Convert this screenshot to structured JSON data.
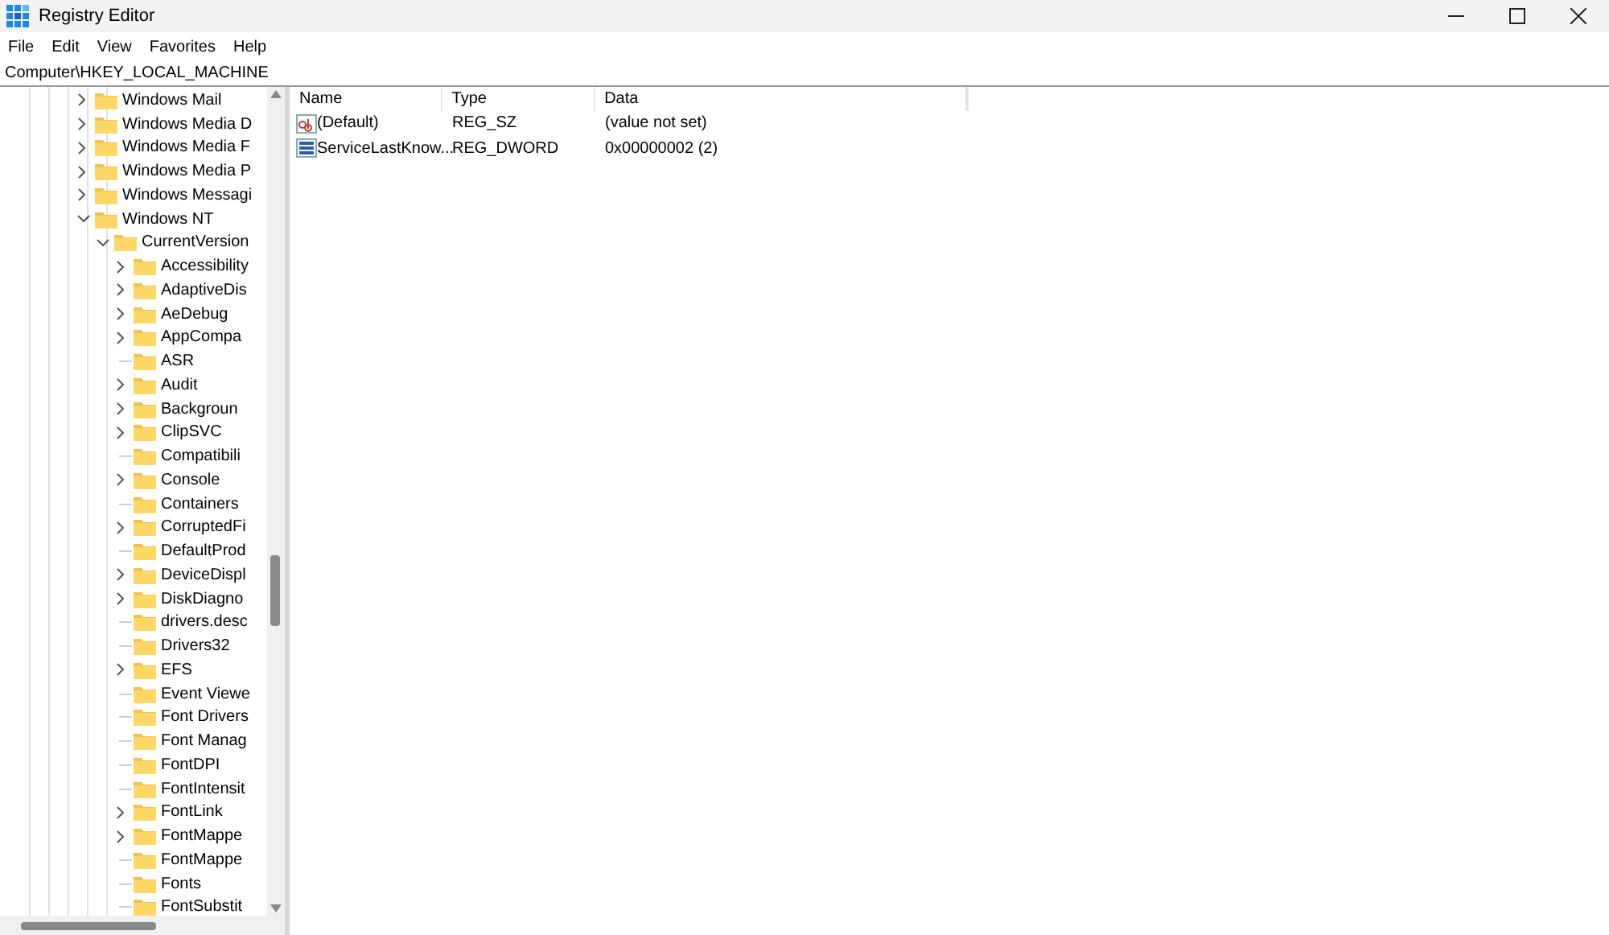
{
  "window": {
    "title": "Registry Editor"
  },
  "menu": [
    "File",
    "Edit",
    "View",
    "Favorites",
    "Help"
  ],
  "address": "Computer\\HKEY_LOCAL_MACHINE",
  "tree": [
    {
      "label": "Windows Mail",
      "expandable": true,
      "expanded": false
    },
    {
      "label": "Windows Media D",
      "expandable": true,
      "expanded": false
    },
    {
      "label": "Windows Media F",
      "expandable": true,
      "expanded": false
    },
    {
      "label": "Windows Media P",
      "expandable": true,
      "expanded": false
    },
    {
      "label": "Windows Messagi",
      "expandable": true,
      "expanded": false
    },
    {
      "label": "Windows NT",
      "expandable": true,
      "expanded": true,
      "children": [
        {
          "label": "CurrentVersion",
          "expandable": true,
          "expanded": true,
          "children": [
            {
              "label": "Accessibility",
              "expandable": true,
              "expanded": false
            },
            {
              "label": "AdaptiveDis",
              "expandable": true,
              "expanded": false
            },
            {
              "label": "AeDebug",
              "expandable": true,
              "expanded": false
            },
            {
              "label": "AppCompa",
              "expandable": true,
              "expanded": false
            },
            {
              "label": "ASR",
              "expandable": false
            },
            {
              "label": "Audit",
              "expandable": true,
              "expanded": false
            },
            {
              "label": "Backgroun",
              "expandable": true,
              "expanded": false
            },
            {
              "label": "ClipSVC",
              "expandable": true,
              "expanded": false
            },
            {
              "label": "Compatibili",
              "expandable": false
            },
            {
              "label": "Console",
              "expandable": true,
              "expanded": false
            },
            {
              "label": "Containers",
              "expandable": false
            },
            {
              "label": "CorruptedFi",
              "expandable": true,
              "expanded": false
            },
            {
              "label": "DefaultProd",
              "expandable": false
            },
            {
              "label": "DeviceDispl",
              "expandable": true,
              "expanded": false
            },
            {
              "label": "DiskDiagno",
              "expandable": true,
              "expanded": false
            },
            {
              "label": "drivers.desc",
              "expandable": false
            },
            {
              "label": "Drivers32",
              "expandable": false
            },
            {
              "label": "EFS",
              "expandable": true,
              "expanded": false
            },
            {
              "label": "Event Viewe",
              "expandable": false
            },
            {
              "label": "Font Drivers",
              "expandable": false
            },
            {
              "label": "Font Manag",
              "expandable": false
            },
            {
              "label": "FontDPI",
              "expandable": false
            },
            {
              "label": "FontIntensit",
              "expandable": false
            },
            {
              "label": "FontLink",
              "expandable": true,
              "expanded": false
            },
            {
              "label": "FontMappe",
              "expandable": true,
              "expanded": false
            },
            {
              "label": "FontMappe",
              "expandable": false
            },
            {
              "label": "Fonts",
              "expandable": false
            },
            {
              "label": "FontSubstit",
              "expandable": false
            }
          ]
        }
      ]
    }
  ],
  "values": {
    "columns": [
      "Name",
      "Type",
      "Data"
    ],
    "rows": [
      {
        "kind": "string",
        "name": "(Default)",
        "type": "REG_SZ",
        "data": "(value not set)"
      },
      {
        "kind": "binary",
        "name": "ServiceLastKnow...",
        "type": "REG_DWORD",
        "data": "0x00000002 (2)"
      }
    ]
  }
}
